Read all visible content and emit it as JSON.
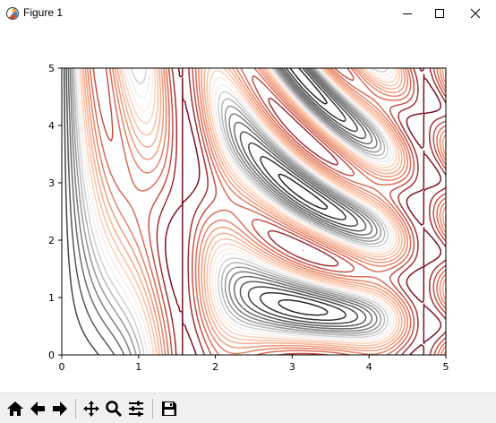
{
  "window": {
    "title": "Figure 1",
    "buttons": {
      "minimize": "minimize-icon",
      "maximize": "maximize-icon",
      "close": "close-icon"
    }
  },
  "toolbar": {
    "buttons": [
      {
        "name": "home",
        "icon": "home-icon"
      },
      {
        "name": "back",
        "icon": "arrow-left-icon"
      },
      {
        "name": "forward",
        "icon": "arrow-right-icon"
      },
      {
        "name": "pan",
        "icon": "move-icon"
      },
      {
        "name": "zoom",
        "icon": "magnifier-icon"
      },
      {
        "name": "configure-subplots",
        "icon": "sliders-icon"
      },
      {
        "name": "save",
        "icon": "floppy-disk-icon"
      }
    ]
  },
  "chart_data": {
    "type": "contour",
    "title": "",
    "xlabel": "",
    "ylabel": "",
    "xlim": [
      0,
      5
    ],
    "ylim": [
      0,
      5
    ],
    "xticks": [
      "0",
      "1",
      "2",
      "3",
      "4",
      "5"
    ],
    "yticks": [
      "0",
      "1",
      "2",
      "3",
      "4",
      "5"
    ],
    "colormap": "RdGy",
    "colors": {
      "positive": "#b2182b",
      "negative": "#4d4d4d",
      "axes": "#000000"
    },
    "grid": false,
    "legend": "none"
  }
}
